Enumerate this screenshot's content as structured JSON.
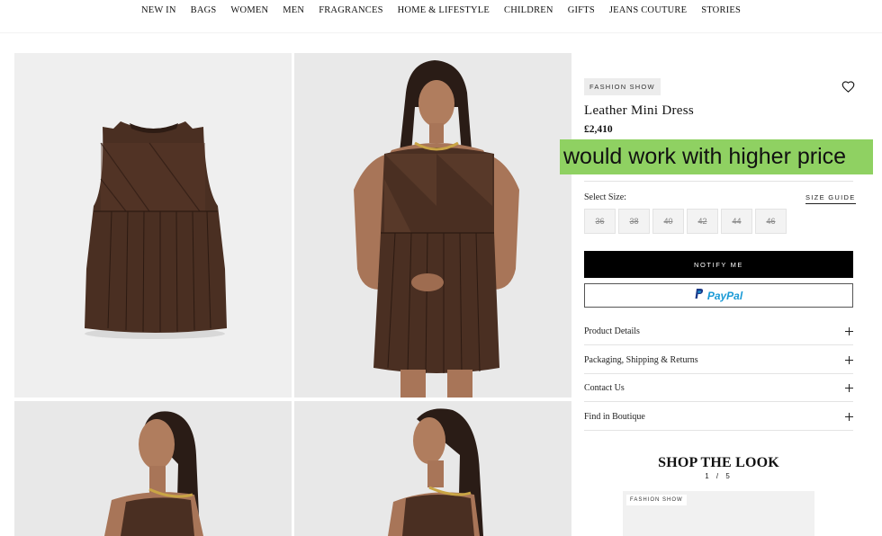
{
  "nav": {
    "items": [
      "NEW IN",
      "BAGS",
      "WOMEN",
      "MEN",
      "FRAGRANCES",
      "HOME & LIFESTYLE",
      "CHILDREN",
      "GIFTS",
      "JEANS COUTURE",
      "STORIES"
    ]
  },
  "product": {
    "badge": "FASHION SHOW",
    "name": "Leather Mini Dress",
    "price": "£2,410",
    "annotation": "would work with higher price",
    "select_size_label": "Select Size:",
    "size_guide_label": "SIZE GUIDE",
    "sizes": [
      "36",
      "38",
      "40",
      "42",
      "44",
      "46"
    ],
    "notify_label": "NOTIFY ME",
    "paypal_label": "PayPal",
    "accordion": [
      "Product Details",
      "Packaging, Shipping & Returns",
      "Contact Us",
      "Find in Boutique"
    ]
  },
  "shop_the_look": {
    "title": "SHOP THE LOOK",
    "pager": "1 / 5",
    "card_badge": "FASHION SHOW"
  },
  "colors": {
    "annotation_bg": "#8fd162",
    "dress_brown": "#4a2f22",
    "paypal_blue": "#1a9ad6"
  },
  "icons": [
    "heart-icon",
    "plus-icon",
    "paypal-logo-icon"
  ]
}
